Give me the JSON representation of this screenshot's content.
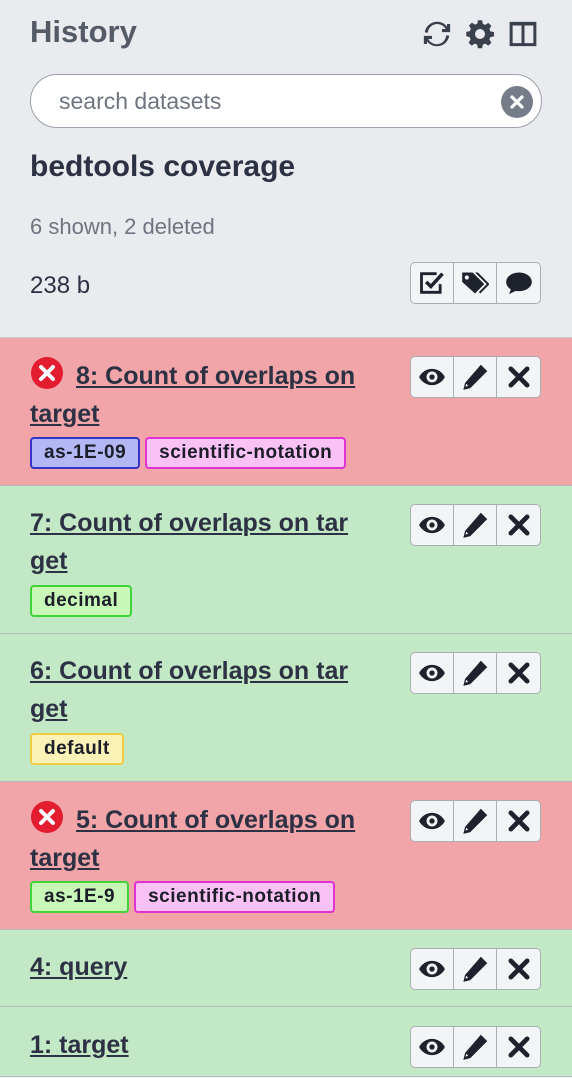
{
  "panel": {
    "title": "History",
    "icons": [
      "refresh-icon",
      "gear-icon",
      "columns-icon"
    ],
    "search_placeholder": "search datasets",
    "history_name": "bedtools coverage",
    "shown_text": "6 shown, 2 deleted",
    "size": "238 b",
    "header_buttons": [
      "select-items-icon",
      "tags-icon",
      "comment-icon"
    ]
  },
  "colors": {
    "error_bg": "#f2a5a8",
    "ok_bg": "#c3e8c5",
    "tag_blue_bg": "#b3b8f5",
    "tag_blue_border": "#3533c8",
    "tag_pink_bg": "#f9c1f4",
    "tag_pink_border": "#e032d2",
    "tag_green_bg": "#c9f7b8",
    "tag_green_border": "#3fd43a",
    "tag_yellow_bg": "#fbf2b8",
    "tag_yellow_border": "#eecc43"
  },
  "datasets": [
    {
      "title": "8: Count of overlaps on target ",
      "state": "error",
      "tags": [
        "as-1E-09",
        "scientific-notation"
      ]
    },
    {
      "title": "7: Count of overlaps on tar get ",
      "state": "ok",
      "tags": [
        "decimal"
      ]
    },
    {
      "title": "6: Count of overlaps on tar get ",
      "state": "ok",
      "tags": [
        "default"
      ]
    },
    {
      "title": "5: Count of overlaps on target ",
      "state": "error",
      "tags": [
        "as-1E-9",
        "scientific-notation"
      ]
    },
    {
      "title": "4: query ",
      "state": "ok",
      "tags": []
    },
    {
      "title": "1: target ",
      "state": "ok",
      "tags": []
    }
  ],
  "dataset_buttons": [
    "eye-icon",
    "pencil-icon",
    "delete-icon"
  ]
}
